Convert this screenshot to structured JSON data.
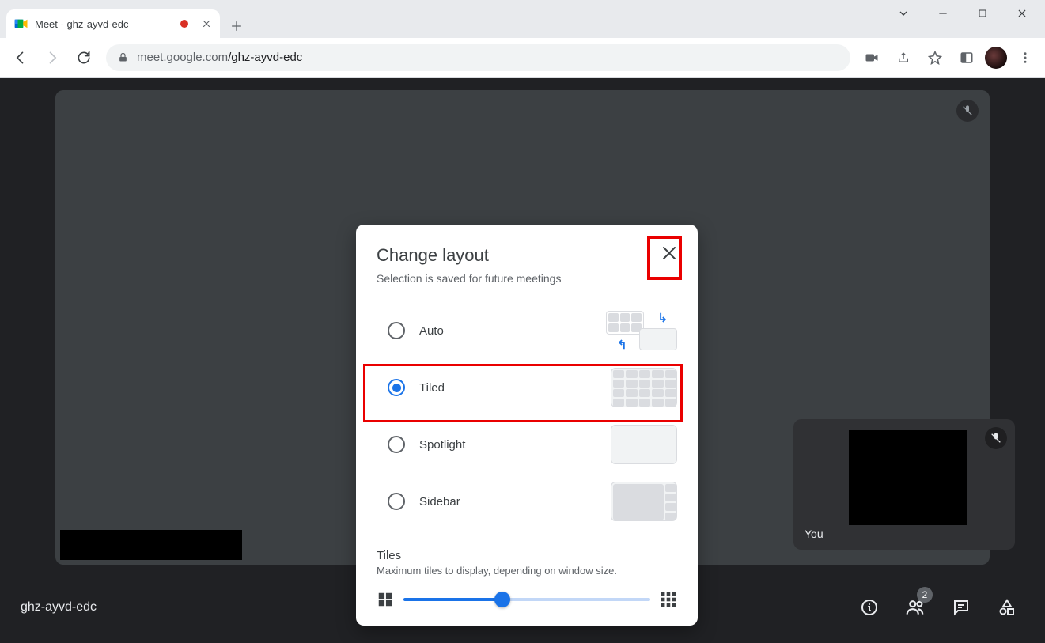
{
  "browser": {
    "tab_title": "Meet - ghz-ayvd-edc",
    "url_prefix": "meet.google.com",
    "url_path": "/ghz-ayvd-edc"
  },
  "meet": {
    "meeting_code": "ghz-ayvd-edc",
    "you_label": "You",
    "participants_badge": "2"
  },
  "dialog": {
    "title": "Change layout",
    "subtitle": "Selection is saved for future meetings",
    "options": {
      "auto": "Auto",
      "tiled": "Tiled",
      "spotlight": "Spotlight",
      "sidebar": "Sidebar"
    },
    "selected": "tiled",
    "tiles_section": {
      "title": "Tiles",
      "description": "Maximum tiles to display, depending on window size."
    }
  }
}
